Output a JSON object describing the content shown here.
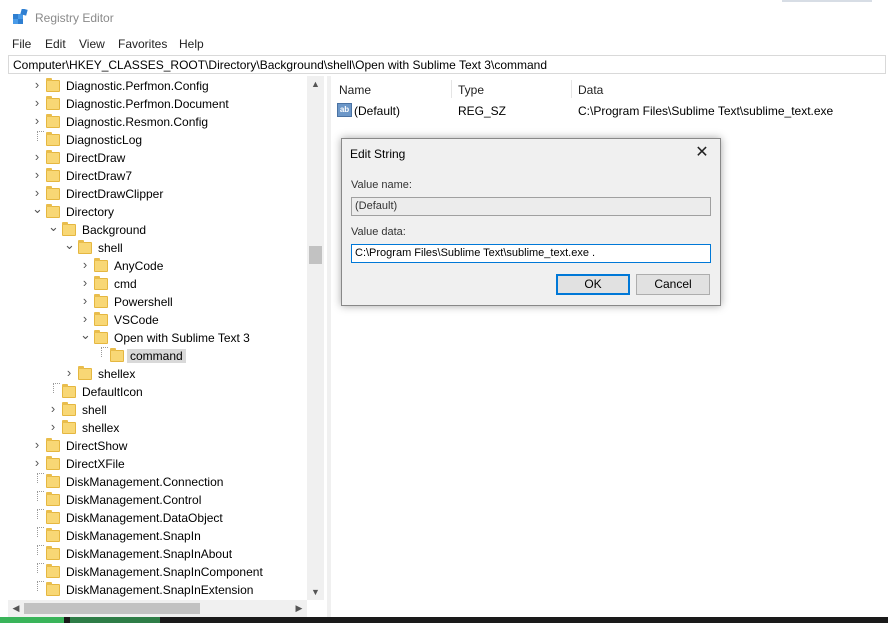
{
  "window": {
    "title": "Registry Editor"
  },
  "menu": [
    "File",
    "Edit",
    "View",
    "Favorites",
    "Help"
  ],
  "address": "Computer\\HKEY_CLASSES_ROOT\\Directory\\Background\\shell\\Open with Sublime Text 3\\command",
  "tree": [
    {
      "label": "Diagnostic.Perfmon.Config",
      "level": 0,
      "expander": "collapsed"
    },
    {
      "label": "Diagnostic.Perfmon.Document",
      "level": 0,
      "expander": "collapsed"
    },
    {
      "label": "Diagnostic.Resmon.Config",
      "level": 0,
      "expander": "collapsed"
    },
    {
      "label": "DiagnosticLog",
      "level": 0,
      "expander": "none"
    },
    {
      "label": "DirectDraw",
      "level": 0,
      "expander": "collapsed"
    },
    {
      "label": "DirectDraw7",
      "level": 0,
      "expander": "collapsed"
    },
    {
      "label": "DirectDrawClipper",
      "level": 0,
      "expander": "collapsed"
    },
    {
      "label": "Directory",
      "level": 0,
      "expander": "expanded"
    },
    {
      "label": "Background",
      "level": 1,
      "expander": "expanded"
    },
    {
      "label": "shell",
      "level": 2,
      "expander": "expanded"
    },
    {
      "label": "AnyCode",
      "level": 3,
      "expander": "collapsed"
    },
    {
      "label": "cmd",
      "level": 3,
      "expander": "collapsed"
    },
    {
      "label": "Powershell",
      "level": 3,
      "expander": "collapsed"
    },
    {
      "label": "VSCode",
      "level": 3,
      "expander": "collapsed"
    },
    {
      "label": "Open with Sublime Text 3",
      "level": 3,
      "expander": "expanded"
    },
    {
      "label": "command",
      "level": 4,
      "expander": "none",
      "selected": true
    },
    {
      "label": "shellex",
      "level": 2,
      "expander": "collapsed"
    },
    {
      "label": "DefaultIcon",
      "level": 1,
      "expander": "none"
    },
    {
      "label": "shell",
      "level": 1,
      "expander": "collapsed"
    },
    {
      "label": "shellex",
      "level": 1,
      "expander": "collapsed"
    },
    {
      "label": "DirectShow",
      "level": 0,
      "expander": "collapsed"
    },
    {
      "label": "DirectXFile",
      "level": 0,
      "expander": "collapsed"
    },
    {
      "label": "DiskManagement.Connection",
      "level": 0,
      "expander": "none"
    },
    {
      "label": "DiskManagement.Control",
      "level": 0,
      "expander": "none"
    },
    {
      "label": "DiskManagement.DataObject",
      "level": 0,
      "expander": "none"
    },
    {
      "label": "DiskManagement.SnapIn",
      "level": 0,
      "expander": "none"
    },
    {
      "label": "DiskManagement.SnapInAbout",
      "level": 0,
      "expander": "none"
    },
    {
      "label": "DiskManagement.SnapInComponent",
      "level": 0,
      "expander": "none"
    },
    {
      "label": "DiskManagement.SnapInExtension",
      "level": 0,
      "expander": "none"
    }
  ],
  "values": {
    "columns": {
      "name": "Name",
      "type": "Type",
      "data": "Data"
    },
    "rows": [
      {
        "icon": "ab",
        "name": "(Default)",
        "type": "REG_SZ",
        "data": "C:\\Program Files\\Sublime Text\\sublime_text.exe"
      }
    ]
  },
  "dialog": {
    "title": "Edit String",
    "value_name_label": "Value name:",
    "value_name": "(Default)",
    "value_data_label": "Value data:",
    "value_data": "C:\\Program Files\\Sublime Text\\sublime_text.exe .",
    "ok_label": "OK",
    "cancel_label": "Cancel"
  },
  "colors": {
    "accent": "#0078d7",
    "folder": "#f8d775",
    "selection": "#d9d9d9"
  }
}
